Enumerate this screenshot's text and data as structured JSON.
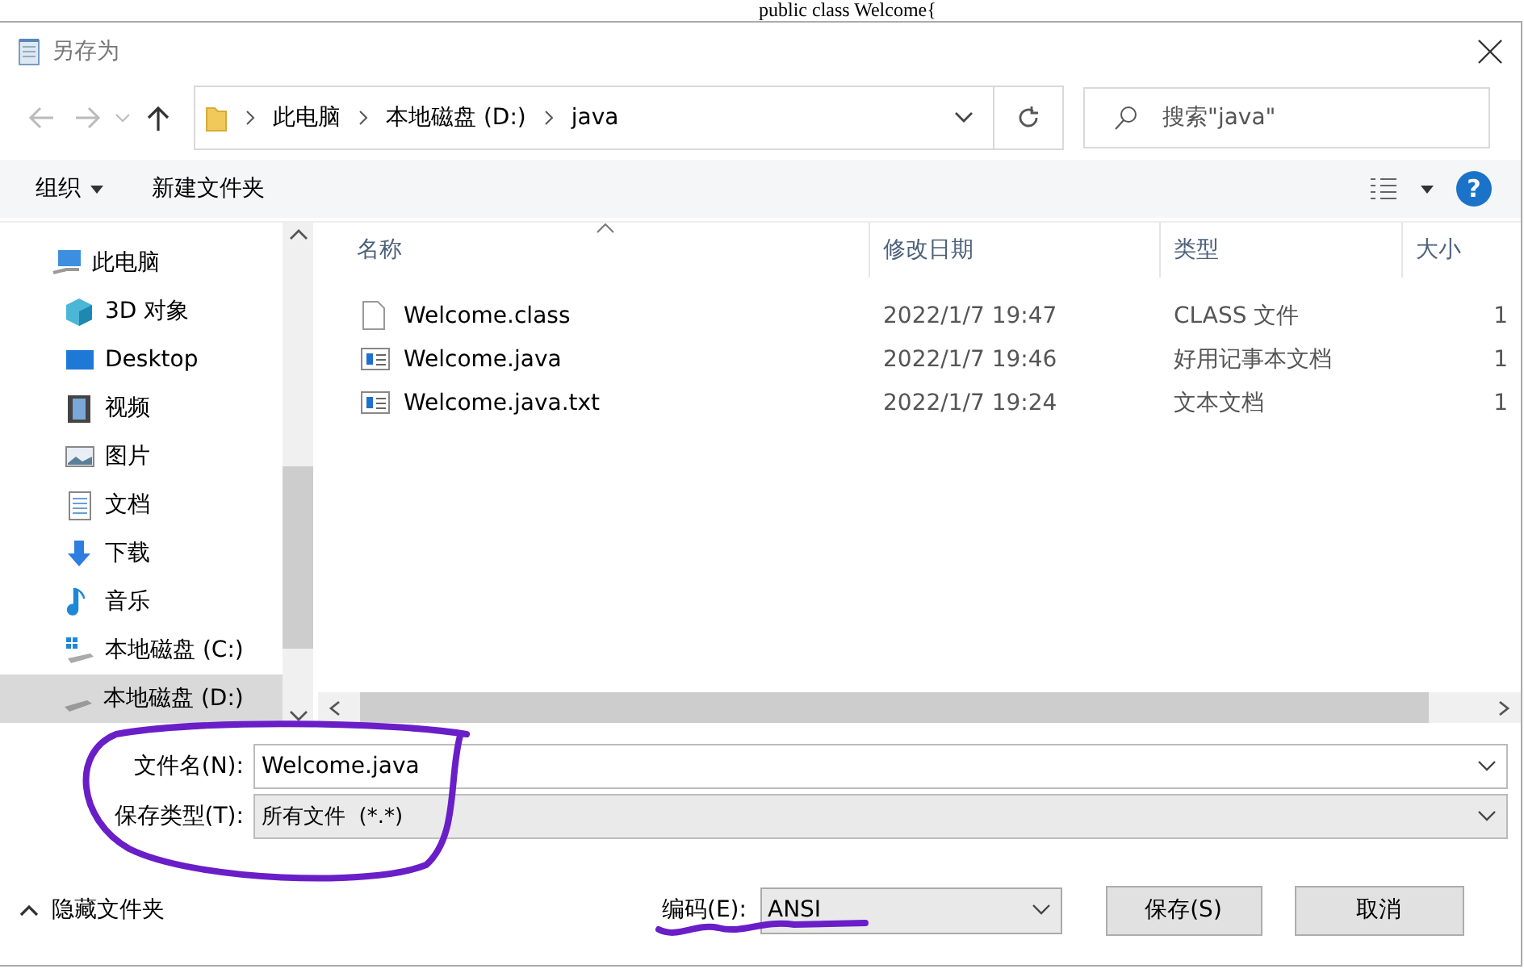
{
  "background_editor": {
    "text": "public class Welcome{"
  },
  "window": {
    "title": "另存为"
  },
  "address_bar": {
    "breadcrumbs": [
      "此电脑",
      "本地磁盘 (D:)",
      "java"
    ]
  },
  "search": {
    "placeholder": "搜索\"java\""
  },
  "toolbar": {
    "organize": "组织",
    "new_folder": "新建文件夹",
    "help": "?"
  },
  "nav_tree": [
    {
      "label": "此电脑",
      "kind": "computer",
      "selected": false,
      "children": [
        {
          "label": "3D 对象",
          "kind": "cube",
          "selected": false
        },
        {
          "label": "Desktop",
          "kind": "desktop",
          "selected": false
        },
        {
          "label": "视频",
          "kind": "film",
          "selected": false
        },
        {
          "label": "图片",
          "kind": "picture",
          "selected": false
        },
        {
          "label": "文档",
          "kind": "document",
          "selected": false
        },
        {
          "label": "下载",
          "kind": "download",
          "selected": false
        },
        {
          "label": "音乐",
          "kind": "music",
          "selected": false
        },
        {
          "label": "本地磁盘 (C:)",
          "kind": "system-drive",
          "selected": false
        },
        {
          "label": "本地磁盘 (D:)",
          "kind": "drive",
          "selected": true
        }
      ]
    }
  ],
  "table": {
    "columns": [
      {
        "label": "名称",
        "sorted": true
      },
      {
        "label": "修改日期",
        "sorted": false
      },
      {
        "label": "类型",
        "sorted": false
      },
      {
        "label": "大小",
        "sorted": false
      }
    ],
    "rows": [
      {
        "kind": "blank",
        "cells": [
          "Welcome.class",
          "2022/1/7 19:47",
          "CLASS 文件",
          "1"
        ]
      },
      {
        "kind": "notepad",
        "cells": [
          "Welcome.java",
          "2022/1/7 19:46",
          "好用记事本文档",
          "1"
        ]
      },
      {
        "kind": "notepad",
        "cells": [
          "Welcome.java.txt",
          "2022/1/7 19:24",
          "文本文档",
          "1"
        ]
      }
    ]
  },
  "form": {
    "filename_label": "文件名(N):",
    "filename": "Welcome.java",
    "filetype_label": "保存类型(T):",
    "filetype": "所有文件  (*.*)"
  },
  "footer": {
    "hide_folders": "隐藏文件夹",
    "encoding_label": "编码(E):",
    "encoding": "ANSI",
    "buttons": [
      "保存(S)",
      "取消"
    ]
  }
}
